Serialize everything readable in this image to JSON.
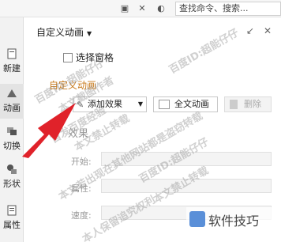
{
  "topbar": {
    "search_text": "查找命令、搜索..."
  },
  "sidebar": {
    "items": [
      {
        "label": "新建",
        "icon": "new-icon"
      },
      {
        "label": "动画",
        "icon": "animation-icon"
      },
      {
        "label": "切换",
        "icon": "transition-icon"
      },
      {
        "label": "形状",
        "icon": "shape-icon"
      },
      {
        "label": "属性",
        "icon": "properties-icon"
      }
    ]
  },
  "panel": {
    "title": "自定义动画",
    "select_pane_label": "选择窗格",
    "section_title": "自定义动画",
    "add_effect_label": "添加效果",
    "full_animation_label": "全文动画",
    "delete_label": "删除",
    "effect_heading": "效果",
    "rows": [
      {
        "label": "开始:"
      },
      {
        "label": "属性:"
      },
      {
        "label": "速度:"
      }
    ]
  },
  "watermarks": [
    "百度ID:超能仔仔",
    "本文截图作者",
    "首发百度经验",
    "本文禁止转载",
    "本文若出现在其他网站都是盗窃转载",
    "本人保留追究权利"
  ],
  "logo": {
    "text": "软件技巧"
  },
  "colors": {
    "accent_orange": "#c8791a",
    "arrow_red": "#e0222a"
  }
}
